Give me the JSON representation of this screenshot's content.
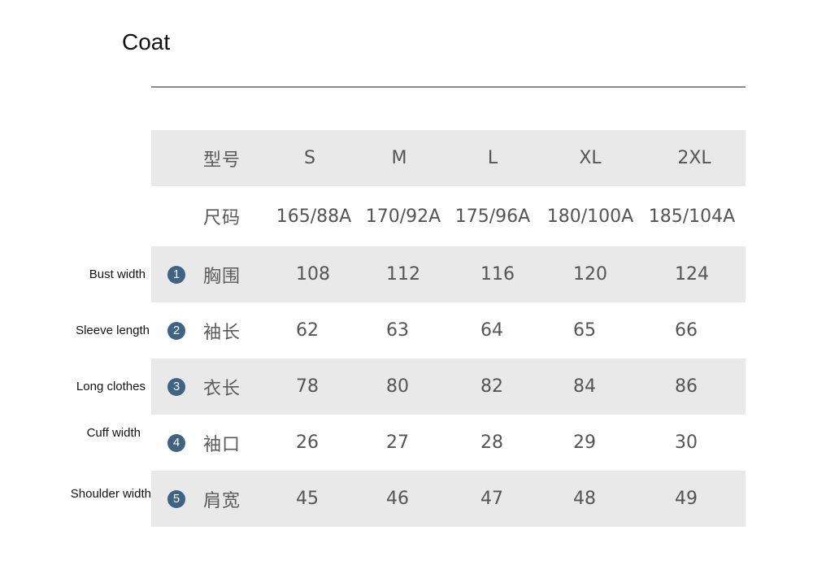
{
  "title": "Coat",
  "header": {
    "model_label": "型号",
    "sizes": [
      "S",
      "M",
      "L",
      "XL",
      "2XL"
    ]
  },
  "size_codes": {
    "label": "尺码",
    "values": [
      "165/88A",
      "170/92A",
      "175/96A",
      "180/100A",
      "185/104A"
    ]
  },
  "measurements": [
    {
      "index": "1",
      "en": "Bust width",
      "cn": "胸围",
      "values": [
        "108",
        "112",
        "116",
        "120",
        "124"
      ]
    },
    {
      "index": "2",
      "en": "Sleeve length",
      "cn": "袖长",
      "values": [
        "62",
        "63",
        "64",
        "65",
        "66"
      ]
    },
    {
      "index": "3",
      "en": "Long clothes",
      "cn": "衣长",
      "values": [
        "78",
        "80",
        "82",
        "84",
        "86"
      ]
    },
    {
      "index": "4",
      "en": "Cuff width",
      "cn": "袖口",
      "values": [
        "26",
        "27",
        "28",
        "29",
        "30"
      ]
    },
    {
      "index": "5",
      "en": "Shoulder width",
      "cn": "肩宽",
      "values": [
        "45",
        "46",
        "47",
        "48",
        "49"
      ]
    }
  ],
  "colors": {
    "badge": "#3e6384",
    "band": "#e9e9e9",
    "text": "#555555"
  }
}
